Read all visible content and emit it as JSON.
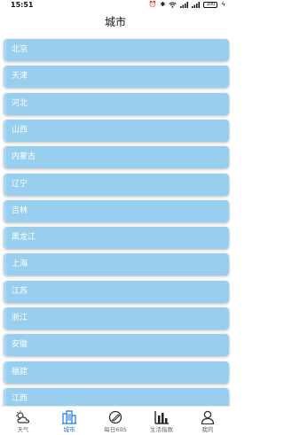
{
  "status_bar": {
    "time": "15:51",
    "battery": "100"
  },
  "header": {
    "title": "城市"
  },
  "cities": [
    "北京",
    "天津",
    "河北",
    "山西",
    "内蒙古",
    "辽宁",
    "吉林",
    "黑龙江",
    "上海",
    "江苏",
    "浙江",
    "安徽",
    "福建",
    "江西"
  ],
  "tabs": [
    {
      "label": "天气",
      "icon": "weather-icon",
      "active": false
    },
    {
      "label": "城市",
      "icon": "city-icon",
      "active": true
    },
    {
      "label": "每日60S",
      "icon": "daily-icon",
      "active": false
    },
    {
      "label": "生活指数",
      "icon": "chart-icon",
      "active": false
    },
    {
      "label": "我的",
      "icon": "user-icon",
      "active": false
    }
  ],
  "colors": {
    "item_bg": "#99cfee",
    "item_text": "#ffffff",
    "active_tab": "#1a73e8"
  }
}
